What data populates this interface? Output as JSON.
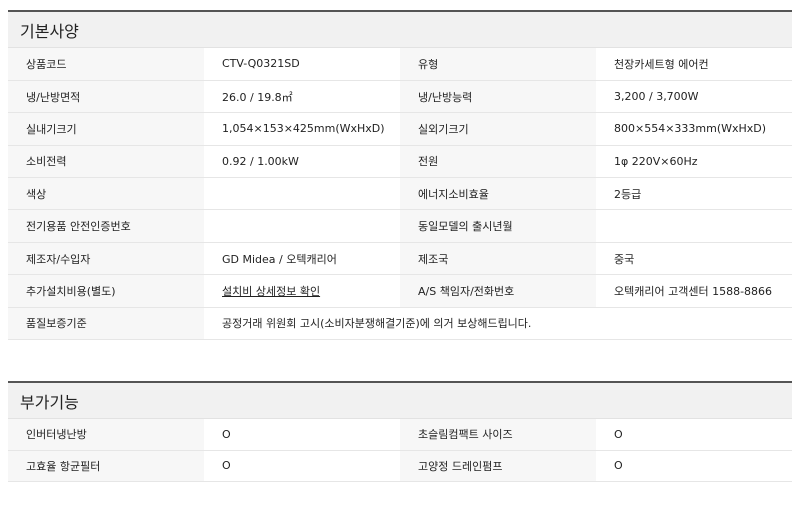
{
  "basic": {
    "title": "기본사양",
    "rows": [
      [
        {
          "label": "상품코드",
          "value": "CTV-Q0321SD"
        },
        {
          "label": "유형",
          "value": "천장카세트형 에어컨"
        }
      ],
      [
        {
          "label": "냉/난방면적",
          "value": "26.0 / 19.8㎡"
        },
        {
          "label": "냉/난방능력",
          "value": "3,200 / 3,700W"
        }
      ],
      [
        {
          "label": "실내기크기",
          "value": "1,054×153×425mm(WxHxD)"
        },
        {
          "label": "실외기크기",
          "value": "800×554×333mm(WxHxD)"
        }
      ],
      [
        {
          "label": "소비전력",
          "value": "0.92 / 1.00kW"
        },
        {
          "label": "전원",
          "value": "1φ 220V×60Hz"
        }
      ],
      [
        {
          "label": "색상",
          "value": ""
        },
        {
          "label": "에너지소비효율",
          "value": "2등급"
        }
      ],
      [
        {
          "label": "전기용품 안전인증번호",
          "value": ""
        },
        {
          "label": "동일모델의 출시년월",
          "value": ""
        }
      ],
      [
        {
          "label": "제조자/수입자",
          "value": "GD Midea / 오텍캐리어"
        },
        {
          "label": "제조국",
          "value": "중국"
        }
      ],
      [
        {
          "label": "추가설치비용(별도)",
          "value": "설치비 상세정보 확인"
        },
        {
          "label": "A/S 책임자/전화번호",
          "value": "오텍캐리어 고객센터 1588-8866"
        }
      ]
    ],
    "warranty": {
      "label": "품질보증기준",
      "value": "공정거래 위원회 고시(소비자분쟁해결기준)에 의거 보상해드립니다."
    }
  },
  "extra": {
    "title": "부가기능",
    "rows": [
      [
        {
          "label": "인버터냉난방",
          "value": "O"
        },
        {
          "label": "초슬림컴팩트 사이즈",
          "value": "O"
        }
      ],
      [
        {
          "label": "고효율 항균필터",
          "value": "O"
        },
        {
          "label": "고양정 드레인펌프",
          "value": "O"
        }
      ]
    ]
  }
}
